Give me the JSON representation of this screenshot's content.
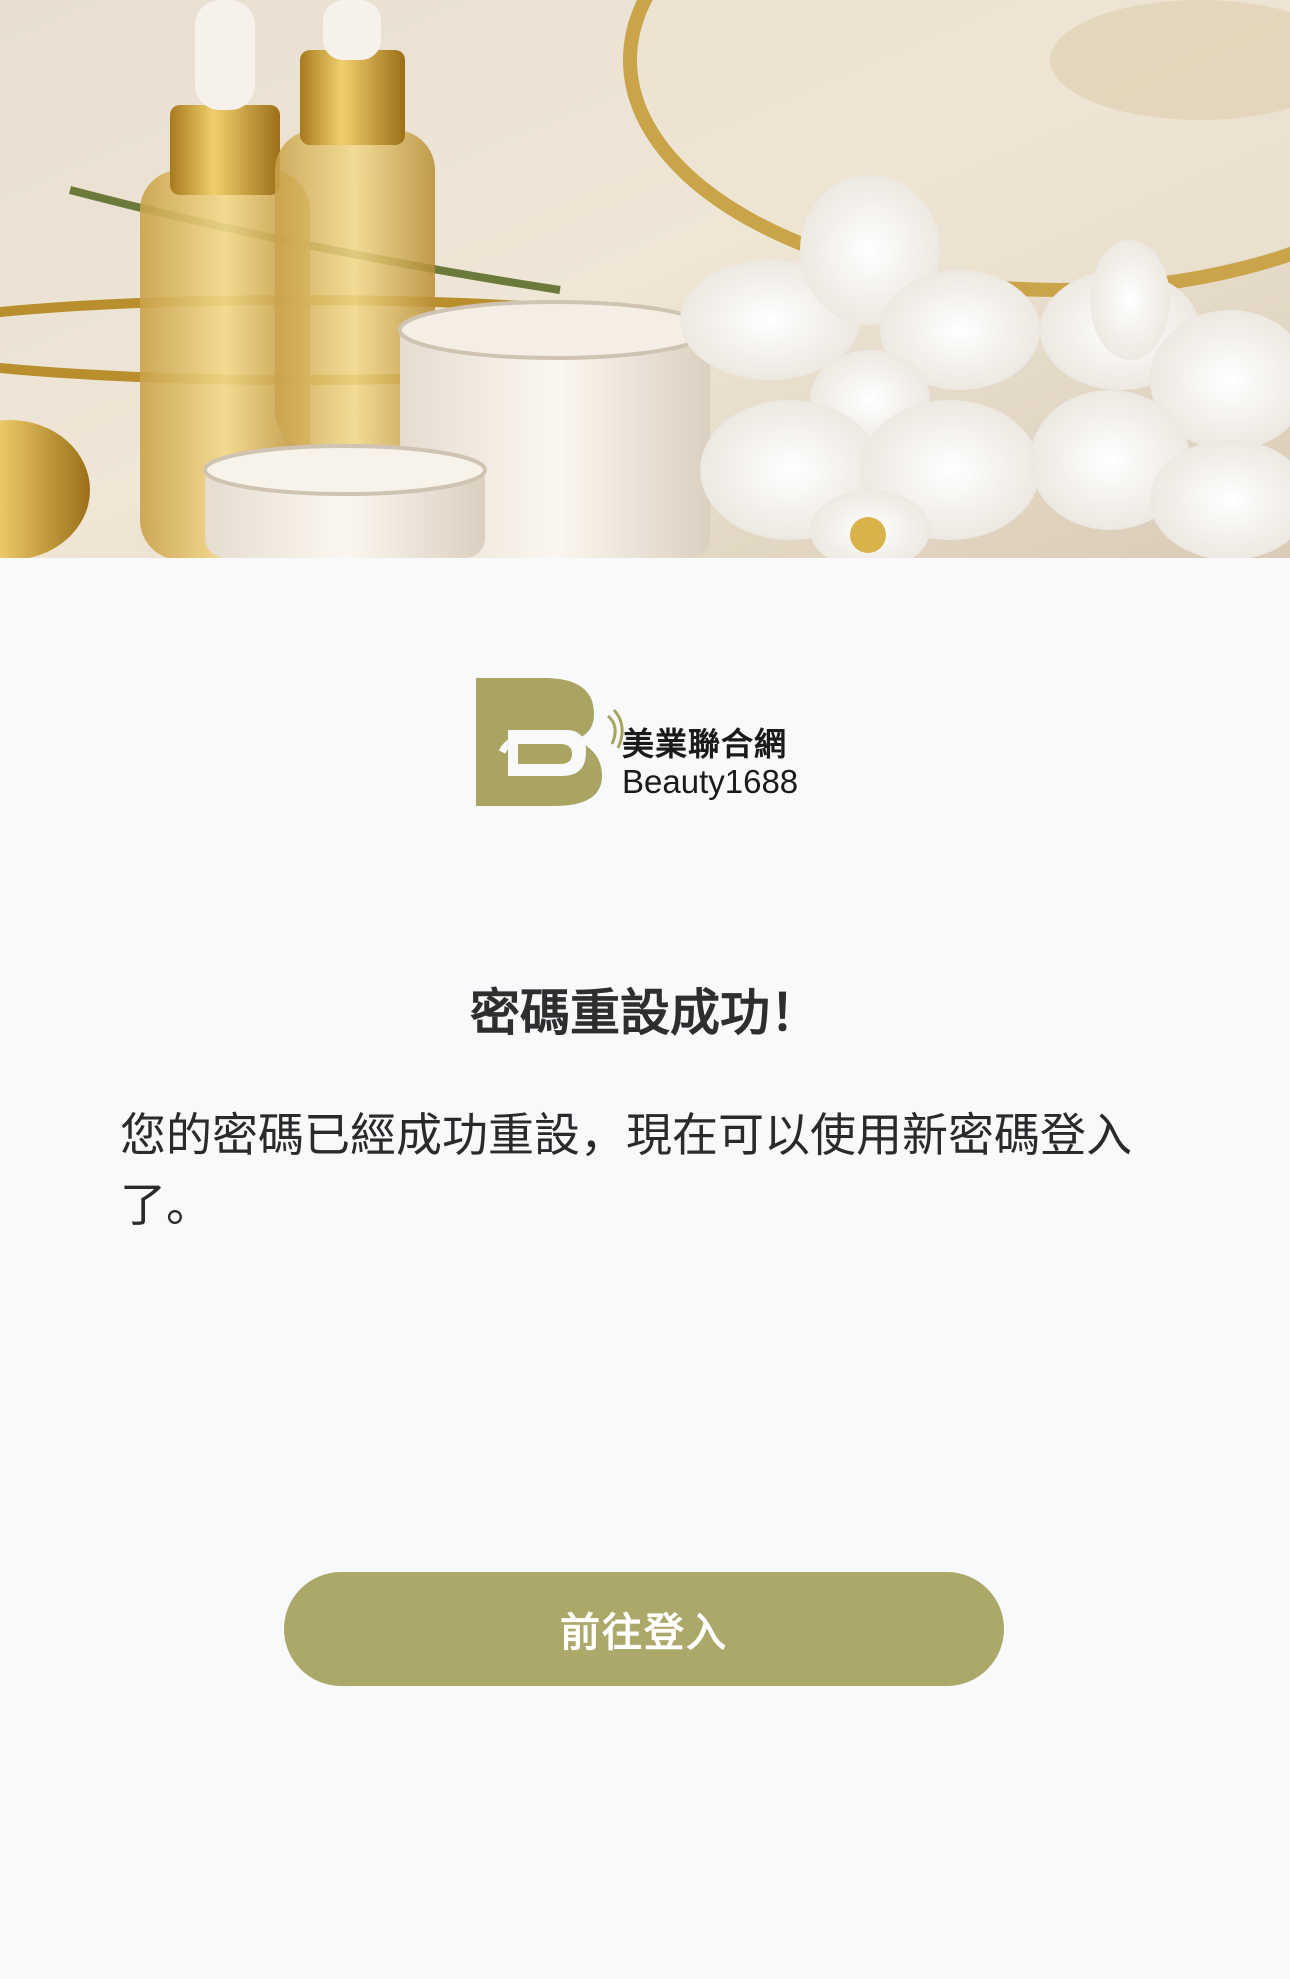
{
  "hero": {
    "image": "skincare-serum-bottles-cream-jars-white-orchids-photo"
  },
  "logo": {
    "mark_icon": "bs-monogram-icon",
    "name_cn": "美業聯合網",
    "name_en": "Beauty1688",
    "brand_color": "#a9a462"
  },
  "content": {
    "title": "密碼重設成功！",
    "message": "您的密碼已經成功重設，現在可以使用新密碼登入了。"
  },
  "actions": {
    "login_label": "前往登入",
    "button_color": "#aba86a"
  }
}
